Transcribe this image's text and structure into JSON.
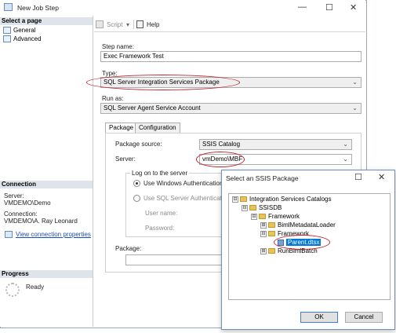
{
  "window": {
    "title": "New Job Step",
    "minimize_glyph": "—",
    "maximize_glyph": "☐",
    "close_glyph": "✕"
  },
  "left_pane": {
    "select_page_header": "Select a page",
    "pages": [
      "General",
      "Advanced"
    ],
    "connection_header": "Connection",
    "server_label": "Server:",
    "server_value": "VMDEMO\\Demo",
    "connection_label": "Connection:",
    "connection_value": "VMDEMO\\A. Ray Leonard",
    "view_connection_link": "View connection properties",
    "progress_header": "Progress",
    "progress_status": "Ready"
  },
  "toolbar": {
    "script_label": "Script",
    "help_label": "Help"
  },
  "form": {
    "step_name_label": "Step name:",
    "step_name_value": "Exec Framework Test",
    "type_label": "Type:",
    "type_value": "SQL Server Integration Services Package",
    "run_as_label": "Run as:",
    "run_as_value": "SQL Server Agent Service Account",
    "tabs": [
      "Package",
      "Configuration"
    ],
    "package_source_label": "Package source:",
    "package_source_value": "SSIS Catalog",
    "server_label": "Server:",
    "server_value": "vmDemo\\MBF",
    "logon_group_label": "Log on to the server",
    "windows_auth_label": "Use Windows Authentication",
    "sql_auth_label": "Use SQL Server Authentication",
    "user_name_label": "User name:",
    "password_label": "Password:",
    "package_label": "Package:"
  },
  "dialog": {
    "title": "Select an SSIS Package",
    "maximize_glyph": "☐",
    "close_glyph": "✕",
    "tree": [
      {
        "label": "Integration Services Catalogs",
        "expander": "⊟"
      },
      {
        "label": "SSISDB",
        "expander": "⊟"
      },
      {
        "label": "Framework",
        "expander": "⊟"
      },
      {
        "label": "BimlMetadataLoader",
        "expander": "⊞"
      },
      {
        "label": "Framework",
        "expander": "⊟"
      },
      {
        "label": "Parent.dtsx",
        "expander": ""
      },
      {
        "label": "RunBimlBatch",
        "expander": "⊞"
      }
    ],
    "ok_label": "OK",
    "cancel_label": "Cancel"
  },
  "colors": {
    "highlight_ellipse": "#c0272d",
    "selection": "#0078d7",
    "link": "#1a4fb4"
  }
}
